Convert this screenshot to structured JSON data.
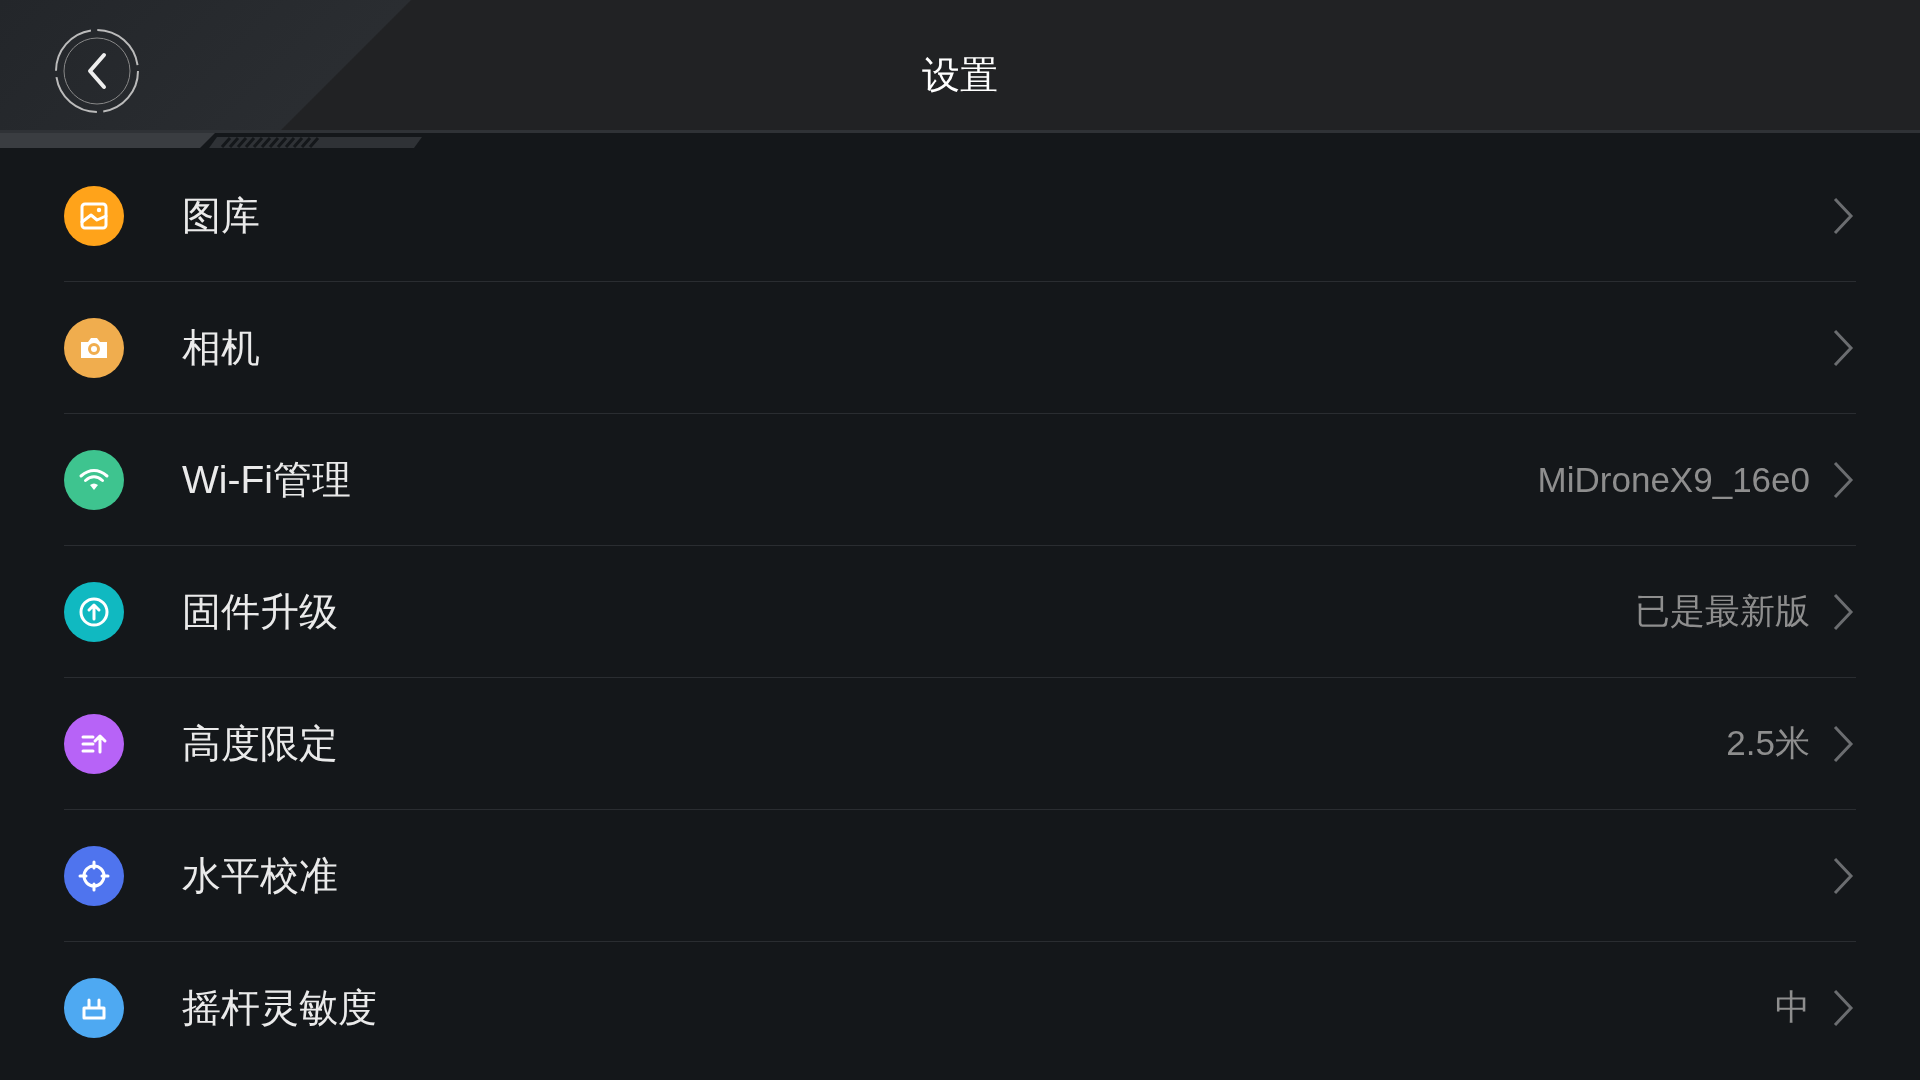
{
  "header": {
    "title": "设置"
  },
  "items": [
    {
      "label": "图库",
      "kind": "gallery",
      "color": "#ffa31a"
    },
    {
      "label": "相机",
      "kind": "camera",
      "color": "#f0ad4e"
    },
    {
      "label": "Wi-Fi管理",
      "kind": "wifi",
      "color": "#3ec48f",
      "value": "MiDroneX9_16e0"
    },
    {
      "label": "固件升级",
      "kind": "upload",
      "color": "#10b9c1",
      "value": "已是最新版"
    },
    {
      "label": "高度限定",
      "kind": "height",
      "color": "#b763f7",
      "value": "2.5米"
    },
    {
      "label": "水平校准",
      "kind": "crosshair",
      "color": "#4f74ee"
    },
    {
      "label": "摇杆灵敏度",
      "kind": "joystick",
      "color": "#4ea9f2",
      "value": "中"
    }
  ]
}
